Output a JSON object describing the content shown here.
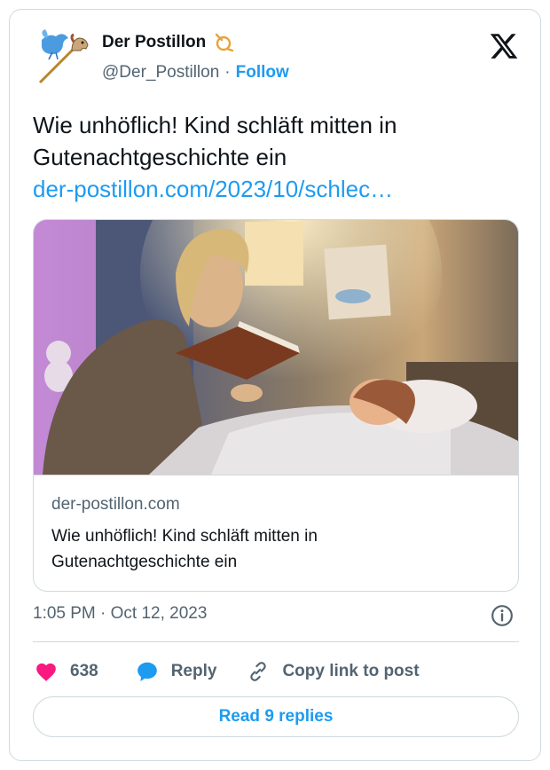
{
  "author": {
    "name": "Der Postillon",
    "handle": "@Der_Postillon",
    "separator": "·",
    "follow_label": "Follow"
  },
  "tweet": {
    "text": "Wie unhöflich! Kind schläft mitten in Gutenachtgeschichte ein",
    "link": "der-postillon.com/2023/10/schlec…"
  },
  "link_card": {
    "domain": "der-postillon.com",
    "title": "Wie unhöflich! Kind schläft mitten in Gutenachtgeschichte ein"
  },
  "timestamp": "1:05 PM · Oct 12, 2023",
  "actions": {
    "likes": "638",
    "reply_label": "Reply",
    "copy_label": "Copy link to post"
  },
  "replies_button": "Read 9 replies",
  "colors": {
    "accent": "#1d9bf0",
    "like": "#f91880",
    "secondary_text": "#536471",
    "border": "#cfd9de"
  }
}
